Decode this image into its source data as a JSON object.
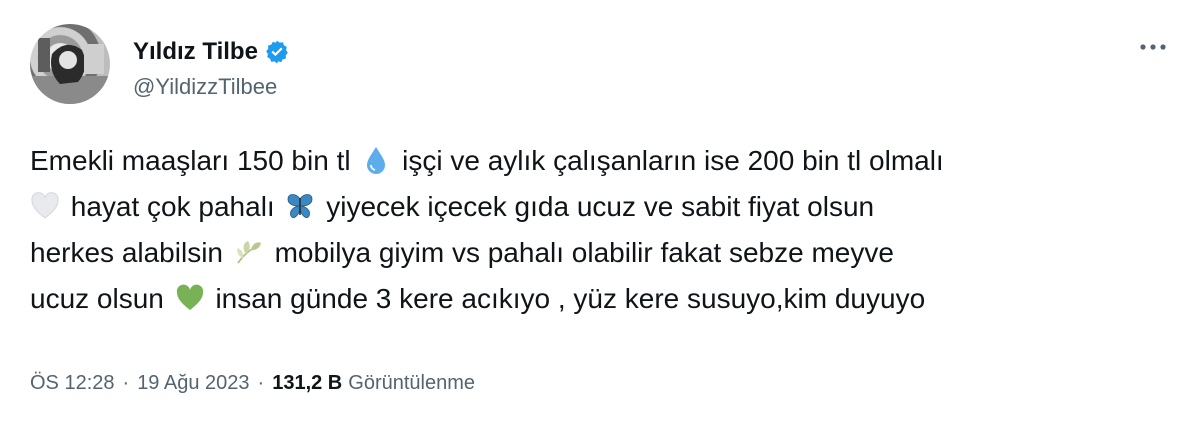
{
  "author": {
    "display_name": "Yıldız Tilbe",
    "handle": "@YildizzTilbee",
    "verified": true
  },
  "tweet": {
    "lines": [
      [
        "Emekli maaşları 150 bin tl",
        "işçi ve aylık çalışanların ise 200 bin tl olmalı"
      ],
      [
        "hayat çok pahalı",
        "yiyecek içecek gıda ucuz ve sabit fiyat olsun"
      ],
      [
        "herkes alabilsin",
        "mobilya giyim vs pahalı olabilir fakat sebze meyve"
      ],
      [
        "ucuz olsun",
        "insan günde 3 kere acıkıyo , yüz kere susuyo,kim duyuyo"
      ]
    ],
    "emojis": [
      "droplet-icon",
      "white-heart-icon",
      "butterfly-icon",
      "leaf-icon",
      "green-heart-icon"
    ]
  },
  "meta": {
    "time": "ÖS 12:28",
    "dot": "·",
    "date": "19 Ağu 2023",
    "views_count": "131,2 B",
    "views_label": "Görüntülenme"
  },
  "colors": {
    "text": "#0f1419",
    "secondary": "#536471",
    "verified_blue": "#1d9bf0"
  }
}
